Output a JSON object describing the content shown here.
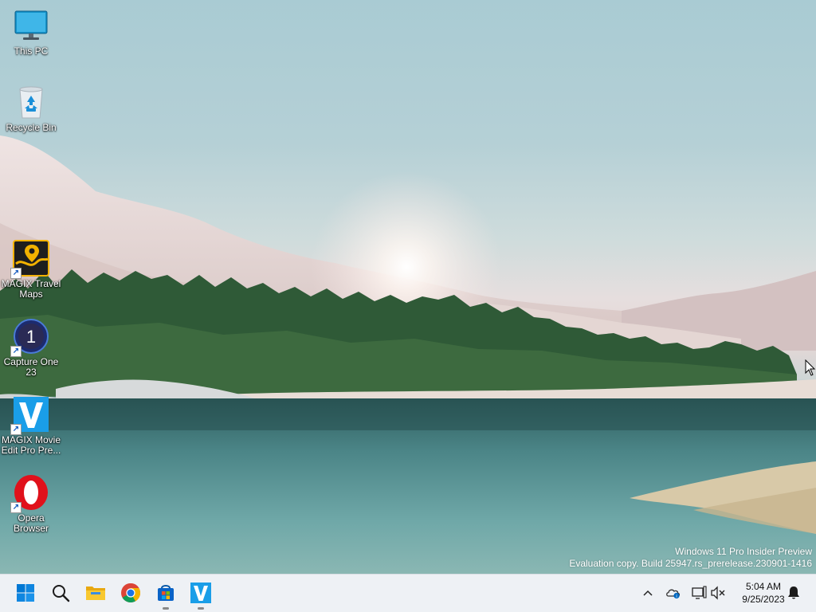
{
  "desktop": {
    "icons": [
      {
        "label": "This PC",
        "icon": "monitor-icon"
      },
      {
        "label": "Recycle Bin",
        "icon": "recycle-bin-icon"
      },
      {
        "label": "MAGIX Travel Maps",
        "icon": "magix-travel-maps-icon"
      },
      {
        "label": "Capture One 23",
        "icon": "capture-one-icon"
      },
      {
        "label": "MAGIX Movie Edit Pro Pre...",
        "icon": "magix-movie-edit-icon"
      },
      {
        "label": "Opera Browser",
        "icon": "opera-icon"
      }
    ],
    "watermark": {
      "line1": "Windows 11 Pro Insider Preview",
      "line2": "Evaluation copy. Build 25947.rs_prerelease.230901-1416"
    }
  },
  "taskbar": {
    "pinned": [
      {
        "name": "Start",
        "icon": "windows-start-icon"
      },
      {
        "name": "Search",
        "icon": "search-icon"
      },
      {
        "name": "File Explorer",
        "icon": "folder-icon"
      },
      {
        "name": "Google Chrome",
        "icon": "chrome-icon"
      },
      {
        "name": "Microsoft Store",
        "icon": "store-icon"
      },
      {
        "name": "MAGIX Movie Edit Pro",
        "icon": "magix-v-icon"
      }
    ],
    "tray": {
      "icons": [
        "chevron-up-icon",
        "onedrive-icon",
        "network-icon",
        "volume-muted-icon",
        "notification-bell-icon"
      ],
      "time": "5:04 AM",
      "date": "9/25/2023"
    }
  },
  "colors": {
    "taskbar_bg": "#eef1f5",
    "windows_blue": "#0078d4",
    "magix_blue": "#1a9ee8",
    "opera_red": "#e0111b"
  }
}
